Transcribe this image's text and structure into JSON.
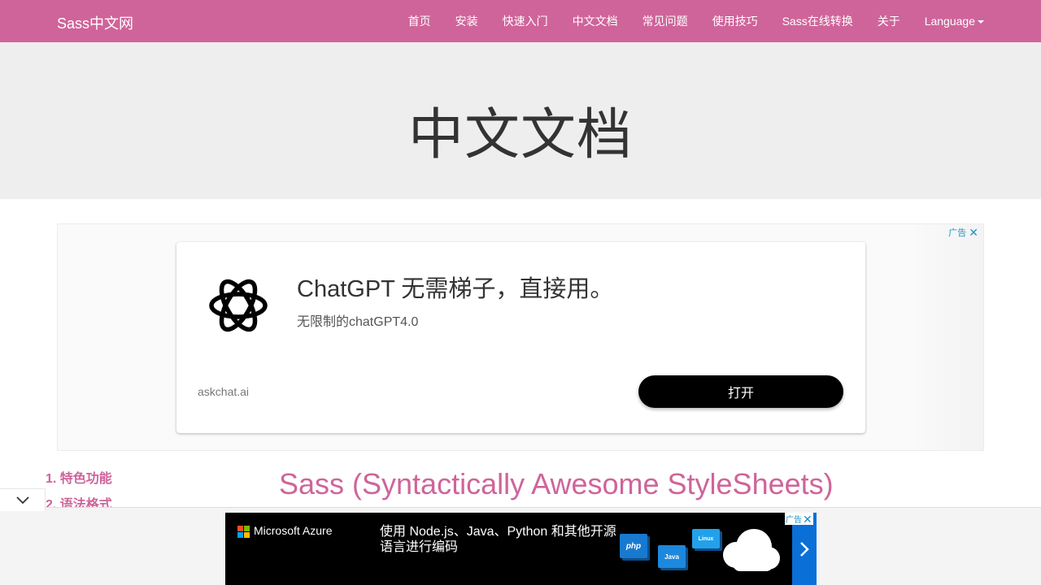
{
  "navbar": {
    "brand": "Sass中文网",
    "items": [
      {
        "label": "首页"
      },
      {
        "label": "安装"
      },
      {
        "label": "快速入门"
      },
      {
        "label": "中文文档"
      },
      {
        "label": "常见问题"
      },
      {
        "label": "使用技巧"
      },
      {
        "label": "Sass在线转换"
      },
      {
        "label": "关于"
      },
      {
        "label": "Language"
      }
    ],
    "background": "#cf649a"
  },
  "header": {
    "title": "中文文档"
  },
  "ad": {
    "label": "广告",
    "close_icon": "close-icon",
    "logo_icon": "chatgpt-logo-icon",
    "headline": "ChatGPT 无需梯子，直接用。",
    "description": "无限制的chatGPT4.0",
    "domain": "askchat.ai",
    "button": "打开"
  },
  "toc": {
    "items": [
      {
        "label": "1. 特色功能"
      },
      {
        "label": "2. 语法格式"
      }
    ]
  },
  "content": {
    "title": "Sass (Syntactically Awesome StyleSheets)"
  },
  "bottom_banner": {
    "label": "广告",
    "brand": "Microsoft Azure",
    "text": "使用 Node.js、Java、Python 和其他开源语言进行编码",
    "tiles": [
      "php",
      "Java",
      "Linux"
    ],
    "arrow_icon": "chevron-right-icon",
    "collapse_icon": "chevron-down-icon"
  },
  "colors": {
    "accent": "#cf649a",
    "adchoices": "#1a91c7",
    "azure_blue": "#0b6fd8"
  }
}
